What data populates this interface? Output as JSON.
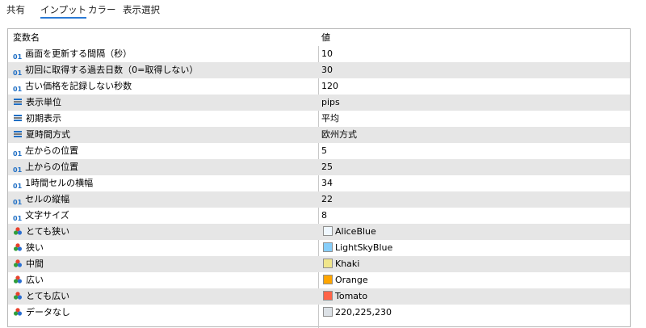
{
  "tabs": [
    {
      "label": "共有",
      "active": false
    },
    {
      "label": "インプット",
      "active": true
    },
    {
      "label": "カラー",
      "active": false
    },
    {
      "label": "表示選択",
      "active": false
    }
  ],
  "table": {
    "headers": {
      "name": "変数名",
      "value": "値"
    },
    "type_glyphs": {
      "int": "01"
    },
    "rows": [
      {
        "type": "int",
        "name": "画面を更新する間隔（秒）",
        "value": "10"
      },
      {
        "type": "int",
        "name": "初回に取得する過去日数（0=取得しない）",
        "value": "30"
      },
      {
        "type": "int",
        "name": "古い価格を記録しない秒数",
        "value": "120"
      },
      {
        "type": "enum",
        "name": "表示単位",
        "value": "pips"
      },
      {
        "type": "enum",
        "name": "初期表示",
        "value": "平均"
      },
      {
        "type": "enum",
        "name": "夏時間方式",
        "value": "欧州方式"
      },
      {
        "type": "int",
        "name": "左からの位置",
        "value": "5"
      },
      {
        "type": "int",
        "name": "上からの位置",
        "value": "25"
      },
      {
        "type": "int",
        "name": "1時間セルの横幅",
        "value": "34"
      },
      {
        "type": "int",
        "name": "セルの縦幅",
        "value": "22"
      },
      {
        "type": "int",
        "name": "文字サイズ",
        "value": "8"
      },
      {
        "type": "color",
        "name": "とても狭い",
        "value": "AliceBlue",
        "swatch": "#F0F8FF"
      },
      {
        "type": "color",
        "name": "狭い",
        "value": "LightSkyBlue",
        "swatch": "#87CEFA"
      },
      {
        "type": "color",
        "name": "中間",
        "value": "Khaki",
        "swatch": "#F0E68C"
      },
      {
        "type": "color",
        "name": "広い",
        "value": "Orange",
        "swatch": "#FFA500"
      },
      {
        "type": "color",
        "name": "とても広い",
        "value": "Tomato",
        "swatch": "#FF6347"
      },
      {
        "type": "color",
        "name": "データなし",
        "value": "220,225,230",
        "swatch": "#DCE1E6"
      }
    ]
  }
}
